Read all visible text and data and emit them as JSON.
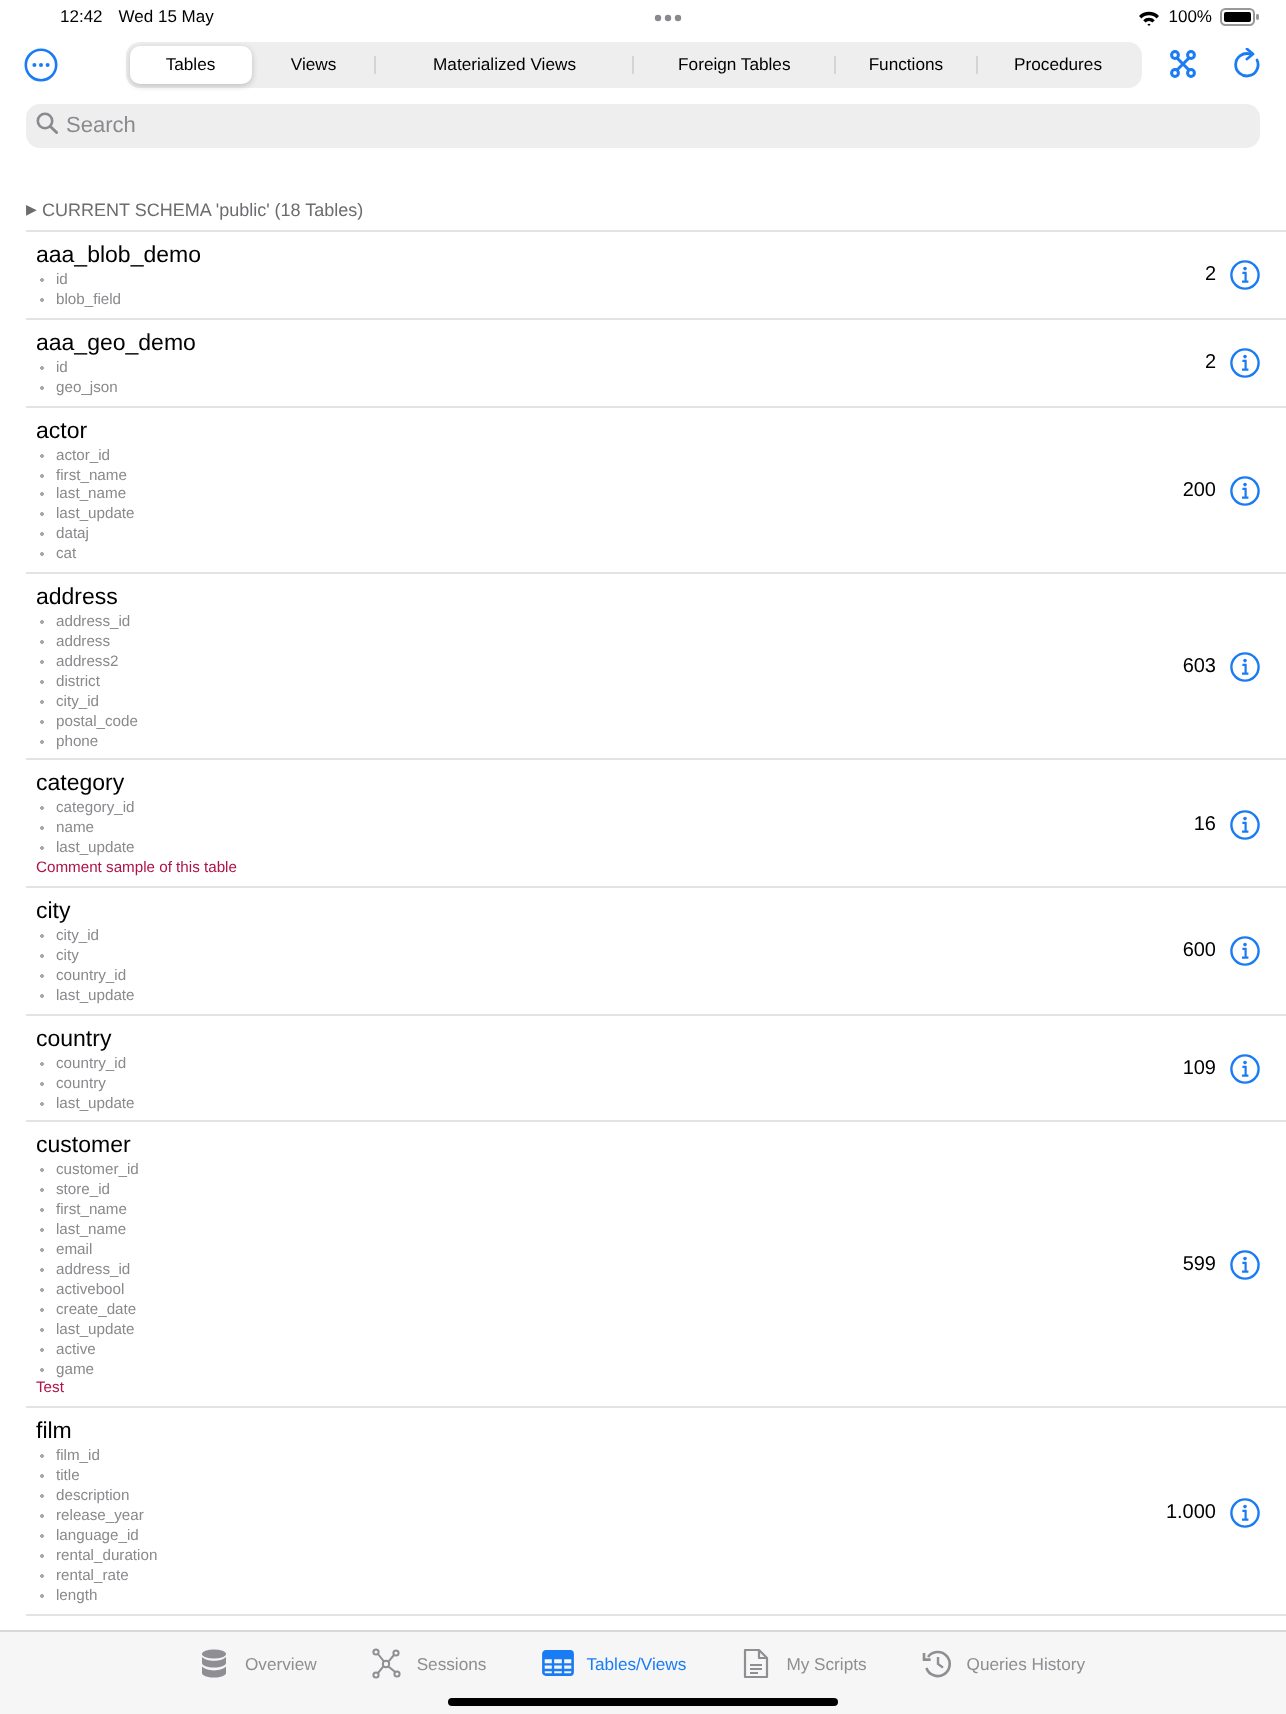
{
  "status_bar": {
    "time": "12:42",
    "date": "Wed 15 May",
    "battery": "100%"
  },
  "segments": [
    {
      "label": "Tables",
      "selected": true
    },
    {
      "label": "Views",
      "selected": false
    },
    {
      "label": "Materialized Views",
      "selected": false
    },
    {
      "label": "Foreign Tables",
      "selected": false
    },
    {
      "label": "Functions",
      "selected": false
    },
    {
      "label": "Procedures",
      "selected": false
    }
  ],
  "search": {
    "placeholder": "Search"
  },
  "schema_header": {
    "toggle": "▶",
    "label": "CURRENT SCHEMA 'public' (18 Tables)"
  },
  "tables": [
    {
      "name": "aaa_blob_demo",
      "columns": [
        "id",
        "blob_field"
      ],
      "count": "2"
    },
    {
      "name": "aaa_geo_demo",
      "columns": [
        "id",
        "geo_json"
      ],
      "count": "2"
    },
    {
      "name": "actor",
      "columns": [
        "actor_id",
        "first_name",
        "last_name",
        "last_update",
        "dataj",
        "cat"
      ],
      "count": "200"
    },
    {
      "name": "address",
      "columns": [
        "address_id",
        "address",
        "address2",
        "district",
        "city_id",
        "postal_code",
        "phone"
      ],
      "count": "603"
    },
    {
      "name": "category",
      "columns": [
        "category_id",
        "name",
        "last_update"
      ],
      "comment": "Comment sample of this table",
      "count": "16"
    },
    {
      "name": "city",
      "columns": [
        "city_id",
        "city",
        "country_id",
        "last_update"
      ],
      "count": "600"
    },
    {
      "name": "country",
      "columns": [
        "country_id",
        "country",
        "last_update"
      ],
      "count": "109"
    },
    {
      "name": "customer",
      "columns": [
        "customer_id",
        "store_id",
        "first_name",
        "last_name",
        "email",
        "address_id",
        "activebool",
        "create_date",
        "last_update",
        "active",
        "game"
      ],
      "comment": "Test",
      "count": "599"
    },
    {
      "name": "film",
      "columns": [
        "film_id",
        "title",
        "description",
        "release_year",
        "language_id",
        "rental_duration",
        "rental_rate",
        "length"
      ],
      "count": "1.000"
    }
  ],
  "tab_bar": [
    {
      "kind": "database",
      "label": "Overview",
      "selected": false
    },
    {
      "kind": "sessions",
      "label": "Sessions",
      "selected": false
    },
    {
      "kind": "grid",
      "label": "Tables/Views",
      "selected": true
    },
    {
      "kind": "document",
      "label": "My Scripts",
      "selected": false
    },
    {
      "kind": "history",
      "label": "Queries History",
      "selected": false
    }
  ]
}
